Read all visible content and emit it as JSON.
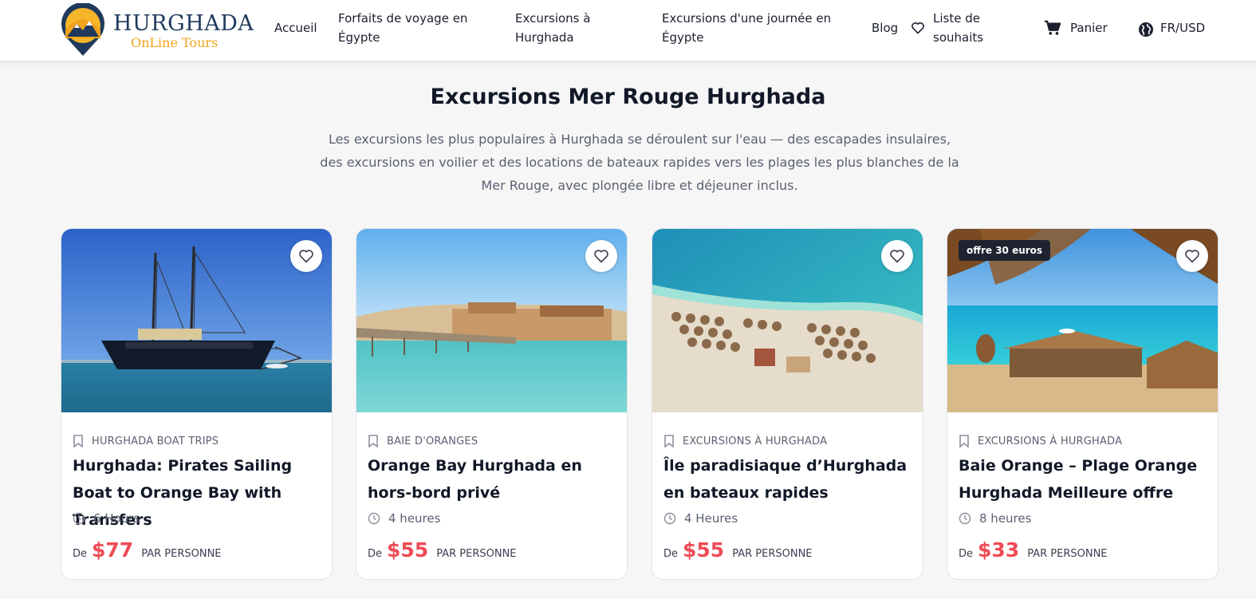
{
  "header": {
    "logo_title": "HURGHADA",
    "logo_subtitle": "OnLine Tours",
    "nav": {
      "accueil": "Accueil",
      "forfaits": "Forfaits de voyage en Égypte",
      "excursions_hurghada": "Excursions à Hurghada",
      "excursions_jour": "Excursions d'une journée en Égypte",
      "blog": "Blog",
      "wishlist": "Liste de souhaits",
      "cart": "Panier",
      "lang_currency": "FR/USD"
    },
    "icons": [
      "heart-icon",
      "cart-icon",
      "globe-icon"
    ]
  },
  "section": {
    "title": "Excursions Mer Rouge Hurghada",
    "description": "Les excursions les plus populaires à Hurghada se déroulent sur l'eau — des escapades insulaires, des excursions en voilier et des locations de bateaux rapides vers les plages les plus blanches de la Mer Rouge, avec plongée libre et déjeuner inclus."
  },
  "cards": [
    {
      "category": "HURGHADA BOAT TRIPS",
      "title": "Hurghada: Pirates Sailing Boat to Orange Bay with Transfers",
      "duration": "6 Hours",
      "price_from": "De",
      "price": "$77",
      "price_unit": "PAR PERSONNE",
      "image": "sailing-ship-photo"
    },
    {
      "category": "BAIE D'ORANGES",
      "title": "Orange Bay Hurghada en hors-bord privé",
      "duration": "4 heures",
      "price_from": "De",
      "price": "$55",
      "price_unit": "PAR PERSONNE",
      "image": "pier-beach-photo"
    },
    {
      "category": "EXCURSIONS À HURGHADA",
      "title": "Île paradisiaque d’Hurghada en bateaux rapides",
      "duration": "4 Heures",
      "price_from": "De",
      "price": "$55",
      "price_unit": "PAR PERSONNE",
      "image": "umbrella-beach-photo"
    },
    {
      "category": "EXCURSIONS À HURGHADA",
      "title": "Baie Orange – Plage Orange Hurghada Meilleure offre",
      "duration": "8 heures",
      "price_from": "De",
      "price": "$33",
      "price_unit": "PAR PERSONNE",
      "badge": "offre 30 euros",
      "image": "palm-hut-beach-photo"
    }
  ],
  "colors": {
    "accent_price": "#ef4b55",
    "logo_navy": "#1f3a5c",
    "logo_orange": "#f0a31b",
    "badge_bg": "#1f2330"
  }
}
